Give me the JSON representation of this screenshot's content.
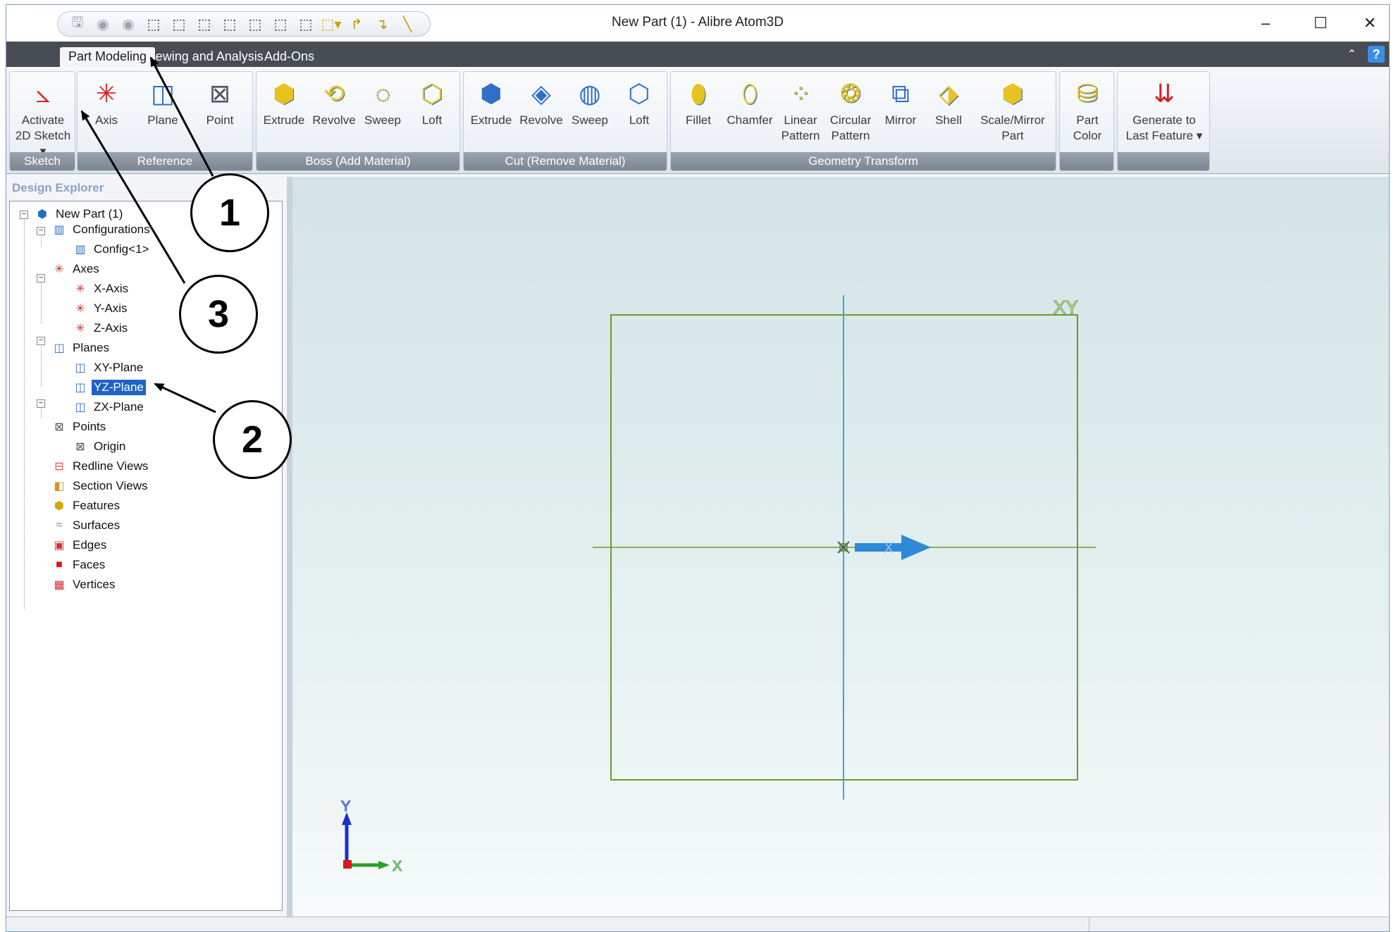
{
  "window": {
    "title": "New Part (1) - Alibre Atom3D",
    "minimize_glyph": "–",
    "maximize_glyph": "☐",
    "close_glyph": "✕"
  },
  "quick_access": {
    "icons": [
      "save-icon",
      "undo-icon",
      "redo-icon",
      "view-iso-icon",
      "view-front-icon",
      "view-back-icon",
      "view-left-icon",
      "view-right-icon",
      "view-top-icon",
      "view-bottom-icon",
      "view-dropdown-icon",
      "rotate-left-icon",
      "rotate-right-icon",
      "measure-icon"
    ]
  },
  "tabs": [
    "Part Modeling",
    "Viewing and Analysis",
    "Add-Ons"
  ],
  "active_tab": "Part Modeling",
  "ribbon": {
    "groups": {
      "sketch": "Sketch",
      "reference": "Reference",
      "boss": "Boss (Add Material)",
      "cut": "Cut (Remove Material)",
      "transform": "Geometry Transform"
    },
    "tools": {
      "activate_sketch": [
        "Activate",
        "2D Sketch ▾"
      ],
      "axis": "Axis",
      "plane": "Plane",
      "point": "Point",
      "boss_extrude": "Extrude",
      "boss_revolve": "Revolve",
      "boss_sweep": "Sweep",
      "boss_loft": "Loft",
      "cut_extrude": "Extrude",
      "cut_revolve": "Revolve",
      "cut_sweep": "Sweep",
      "cut_loft": "Loft",
      "fillet": "Fillet",
      "chamfer": "Chamfer",
      "linear_pattern": [
        "Linear",
        "Pattern"
      ],
      "circular_pattern": [
        "Circular",
        "Pattern"
      ],
      "mirror": "Mirror",
      "shell": "Shell",
      "scale_mirror": [
        "Scale/Mirror",
        "Part"
      ],
      "part_color": [
        "Part",
        "Color"
      ],
      "generate": [
        "Generate to",
        "Last Feature ▾"
      ]
    }
  },
  "explorer": {
    "title": "Design Explorer",
    "items": [
      {
        "label": "New Part (1)",
        "icon": "part-icon"
      },
      {
        "label": "Configurations",
        "icon": "configurations-icon"
      },
      {
        "label": "Config<1>",
        "icon": "config-icon"
      },
      {
        "label": "Axes",
        "icon": "axes-icon"
      },
      {
        "label": "X-Axis",
        "icon": "axis-icon"
      },
      {
        "label": "Y-Axis",
        "icon": "axis-icon"
      },
      {
        "label": "Z-Axis",
        "icon": "axis-icon"
      },
      {
        "label": "Planes",
        "icon": "planes-icon"
      },
      {
        "label": "XY-Plane",
        "icon": "plane-icon"
      },
      {
        "label": "YZ-Plane",
        "icon": "plane-icon"
      },
      {
        "label": "ZX-Plane",
        "icon": "plane-icon"
      },
      {
        "label": "Points",
        "icon": "points-icon"
      },
      {
        "label": "Origin",
        "icon": "origin-icon"
      },
      {
        "label": "Redline Views",
        "icon": "redline-icon"
      },
      {
        "label": "Section Views",
        "icon": "section-icon"
      },
      {
        "label": "Features",
        "icon": "features-icon"
      },
      {
        "label": "Surfaces",
        "icon": "surfaces-icon"
      },
      {
        "label": "Edges",
        "icon": "edges-icon"
      },
      {
        "label": "Faces",
        "icon": "faces-icon"
      },
      {
        "label": "Vertices",
        "icon": "vertices-icon"
      }
    ],
    "selected": "YZ-Plane"
  },
  "viewport": {
    "plane_label": "XY",
    "triad_y": "Y",
    "triad_x": "X",
    "plane_color": "#6a9a2a",
    "axis_color": "#3aa6e0"
  },
  "callouts": [
    "1",
    "2",
    "3"
  ]
}
